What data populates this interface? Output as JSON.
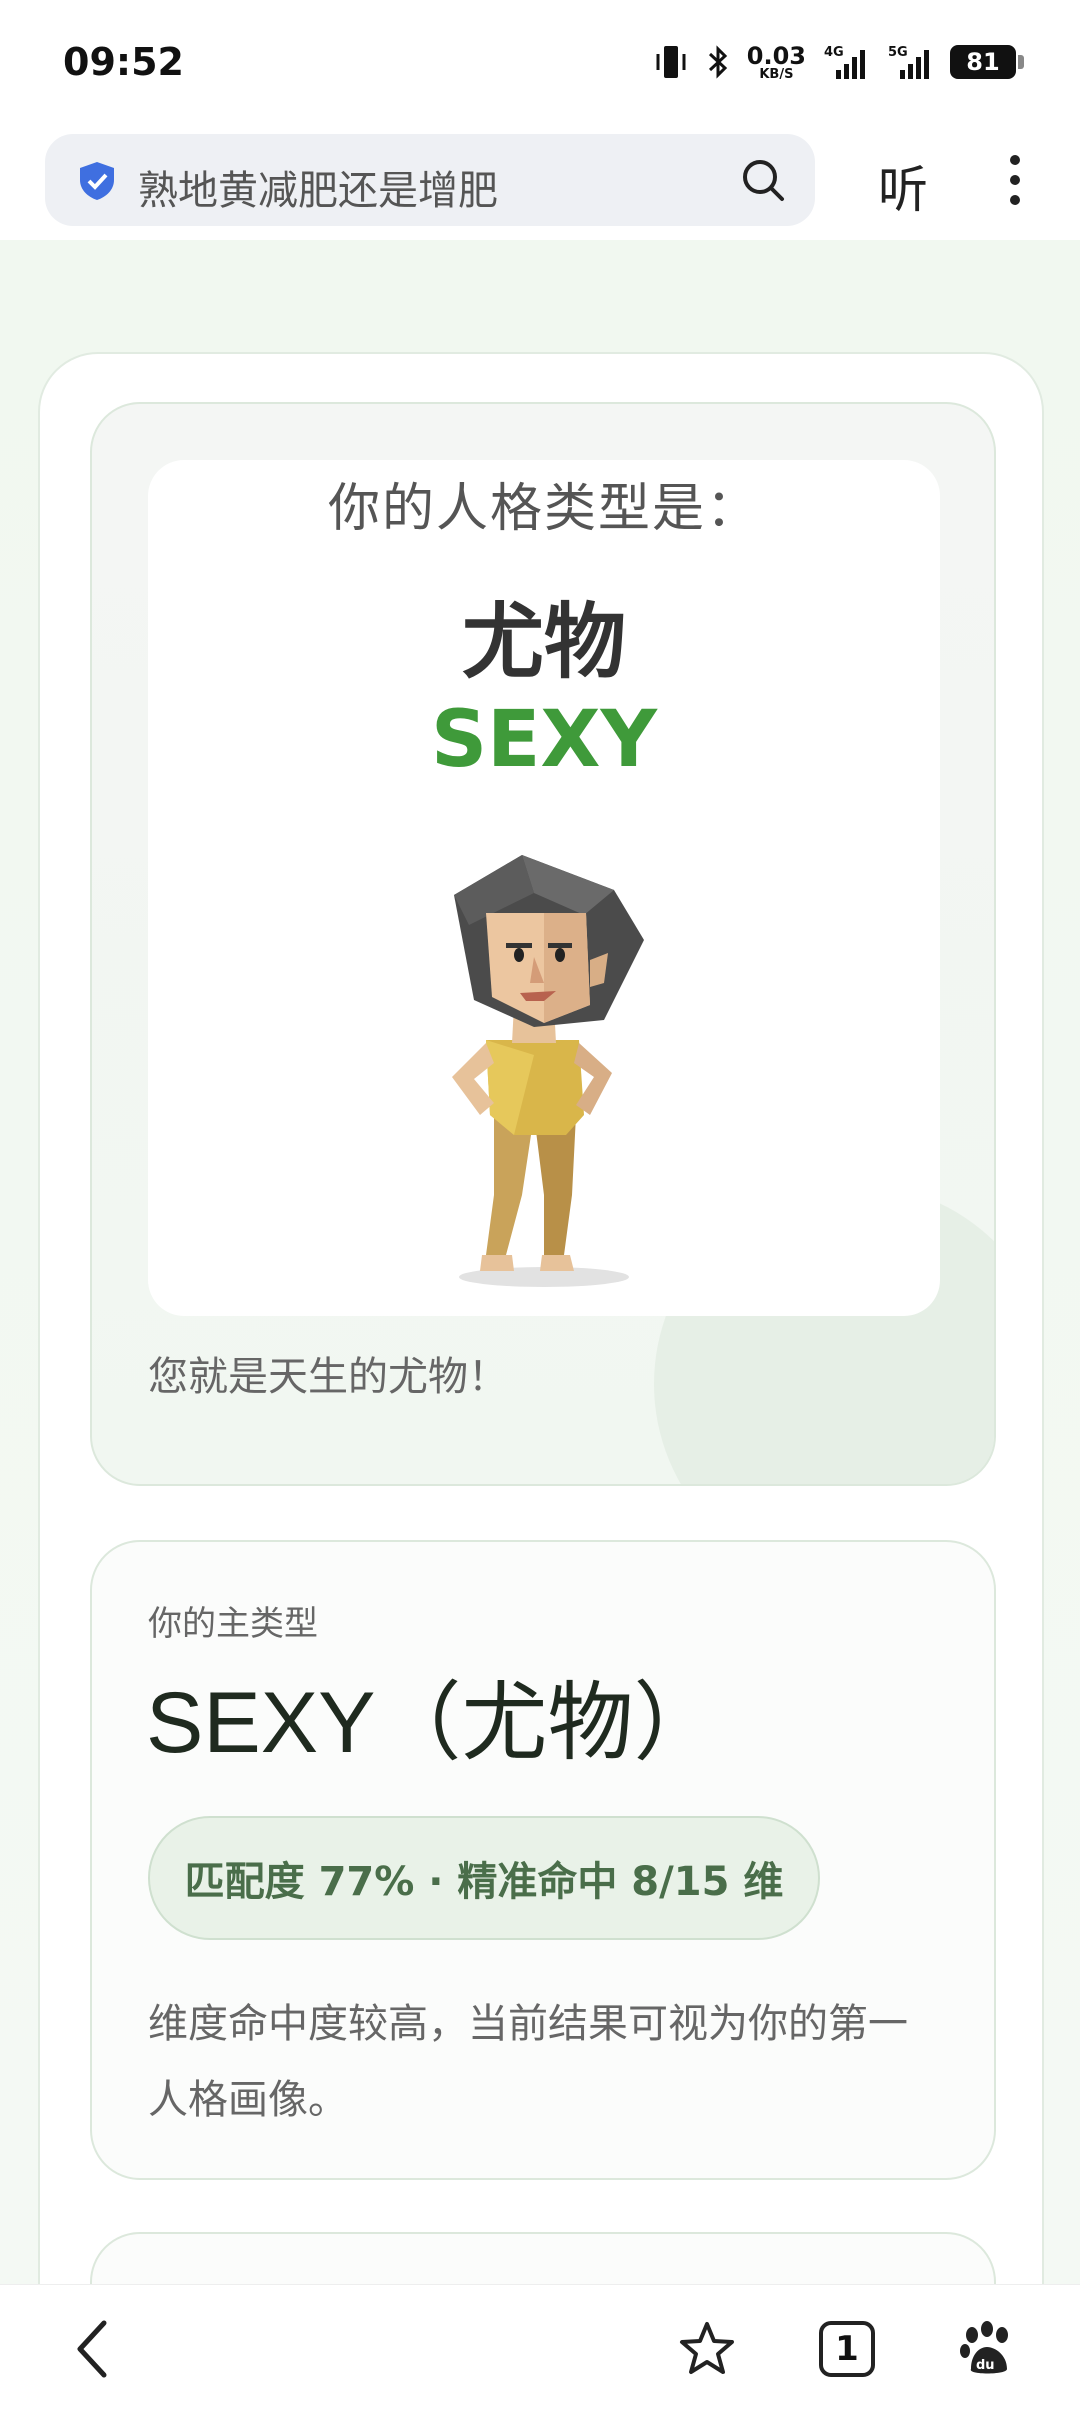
{
  "status_bar": {
    "time": "09:52",
    "net_speed_value": "0.03",
    "net_speed_unit": "KB/S",
    "signal_1": "4G",
    "signal_2": "5G",
    "battery": "81"
  },
  "address_bar": {
    "search_text": "熟地黄减肥还是增肥",
    "listen_label": "听"
  },
  "result_card": {
    "heading": "你的人格类型是：",
    "type_name_cn": "尤物",
    "type_name_en": "SEXY",
    "description": "您就是天生的尤物！"
  },
  "type_card": {
    "label": "你的主类型",
    "title": "SEXY（尤物）",
    "match": "匹配度 77% · 精准命中 8/15 维",
    "description": "维度命中度较高，当前结果可视为你的第一人格画像。"
  },
  "bottom_nav": {
    "tab_count": "1"
  },
  "colors": {
    "accent_green": "#3f9a3a",
    "pill_bg": "#e9f2e8",
    "page_bg": "#f3f8f3"
  }
}
